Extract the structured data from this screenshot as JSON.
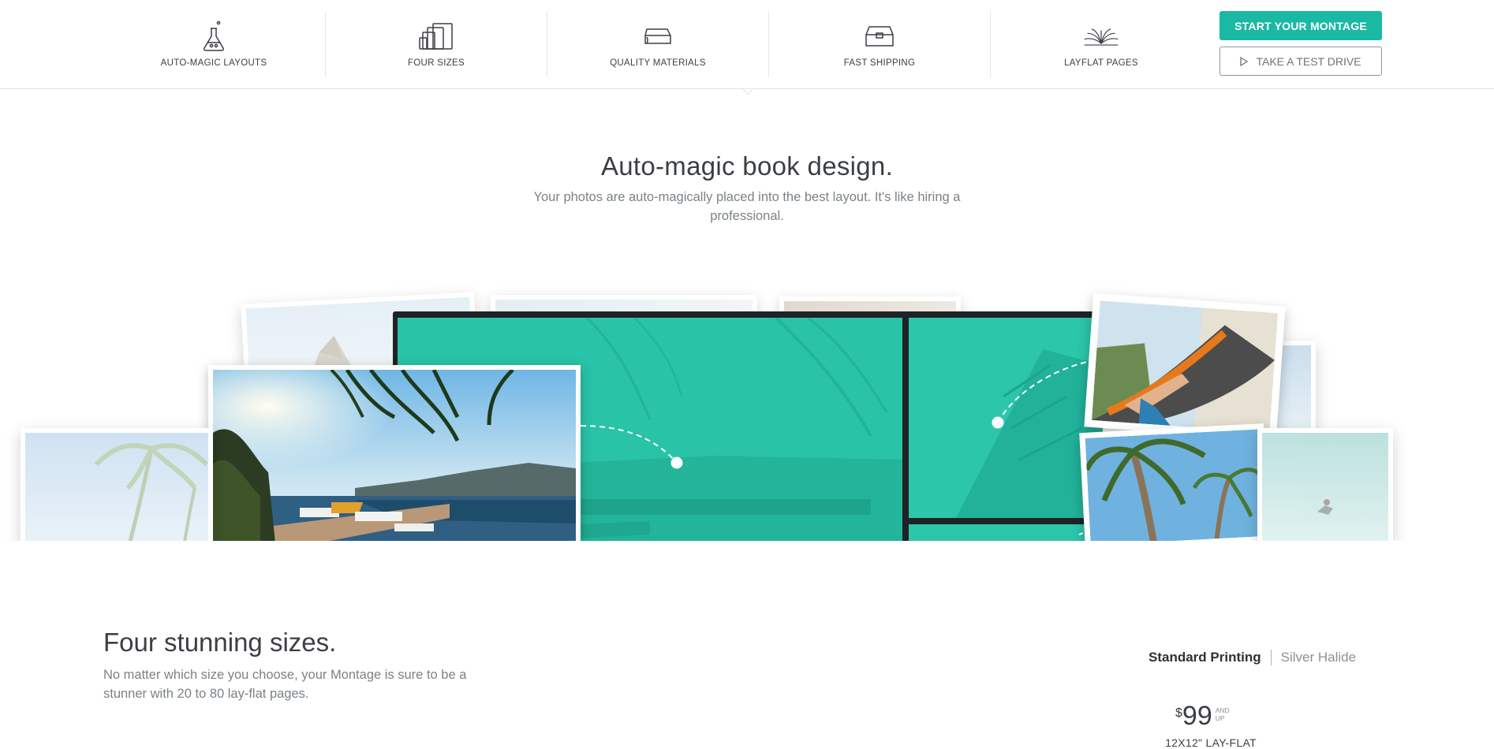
{
  "nav": {
    "features": [
      {
        "label": "AUTO-MAGIC LAYOUTS",
        "icon": "flask-icon"
      },
      {
        "label": "FOUR SIZES",
        "icon": "sizes-icon"
      },
      {
        "label": "QUALITY MATERIALS",
        "icon": "book-materials-icon"
      },
      {
        "label": "FAST SHIPPING",
        "icon": "shipping-box-icon"
      },
      {
        "label": "LAYFLAT PAGES",
        "icon": "open-book-icon"
      }
    ],
    "start_button": "START YOUR MONTAGE",
    "test_button": "TAKE A TEST DRIVE"
  },
  "hero": {
    "title": "Auto-magic book design.",
    "subtitle": "Your photos are auto-magically placed into the best layout. It's like hiring a professional."
  },
  "sizes": {
    "title": "Four stunning sizes.",
    "description": "No matter which size you choose, your Montage is sure to be a stunner with 20 to 80 lay-flat pages.",
    "toggle_active": "Standard Printing",
    "toggle_inactive": "Silver Halide",
    "currency": "$",
    "price": "99",
    "and_up": "AND UP",
    "size_label": "12X12\" LAY-FLAT"
  },
  "colors": {
    "accent": "#19b9a3",
    "layout_teal": "#27c2a6",
    "text": "#3b3f44",
    "muted": "#7b8287"
  }
}
